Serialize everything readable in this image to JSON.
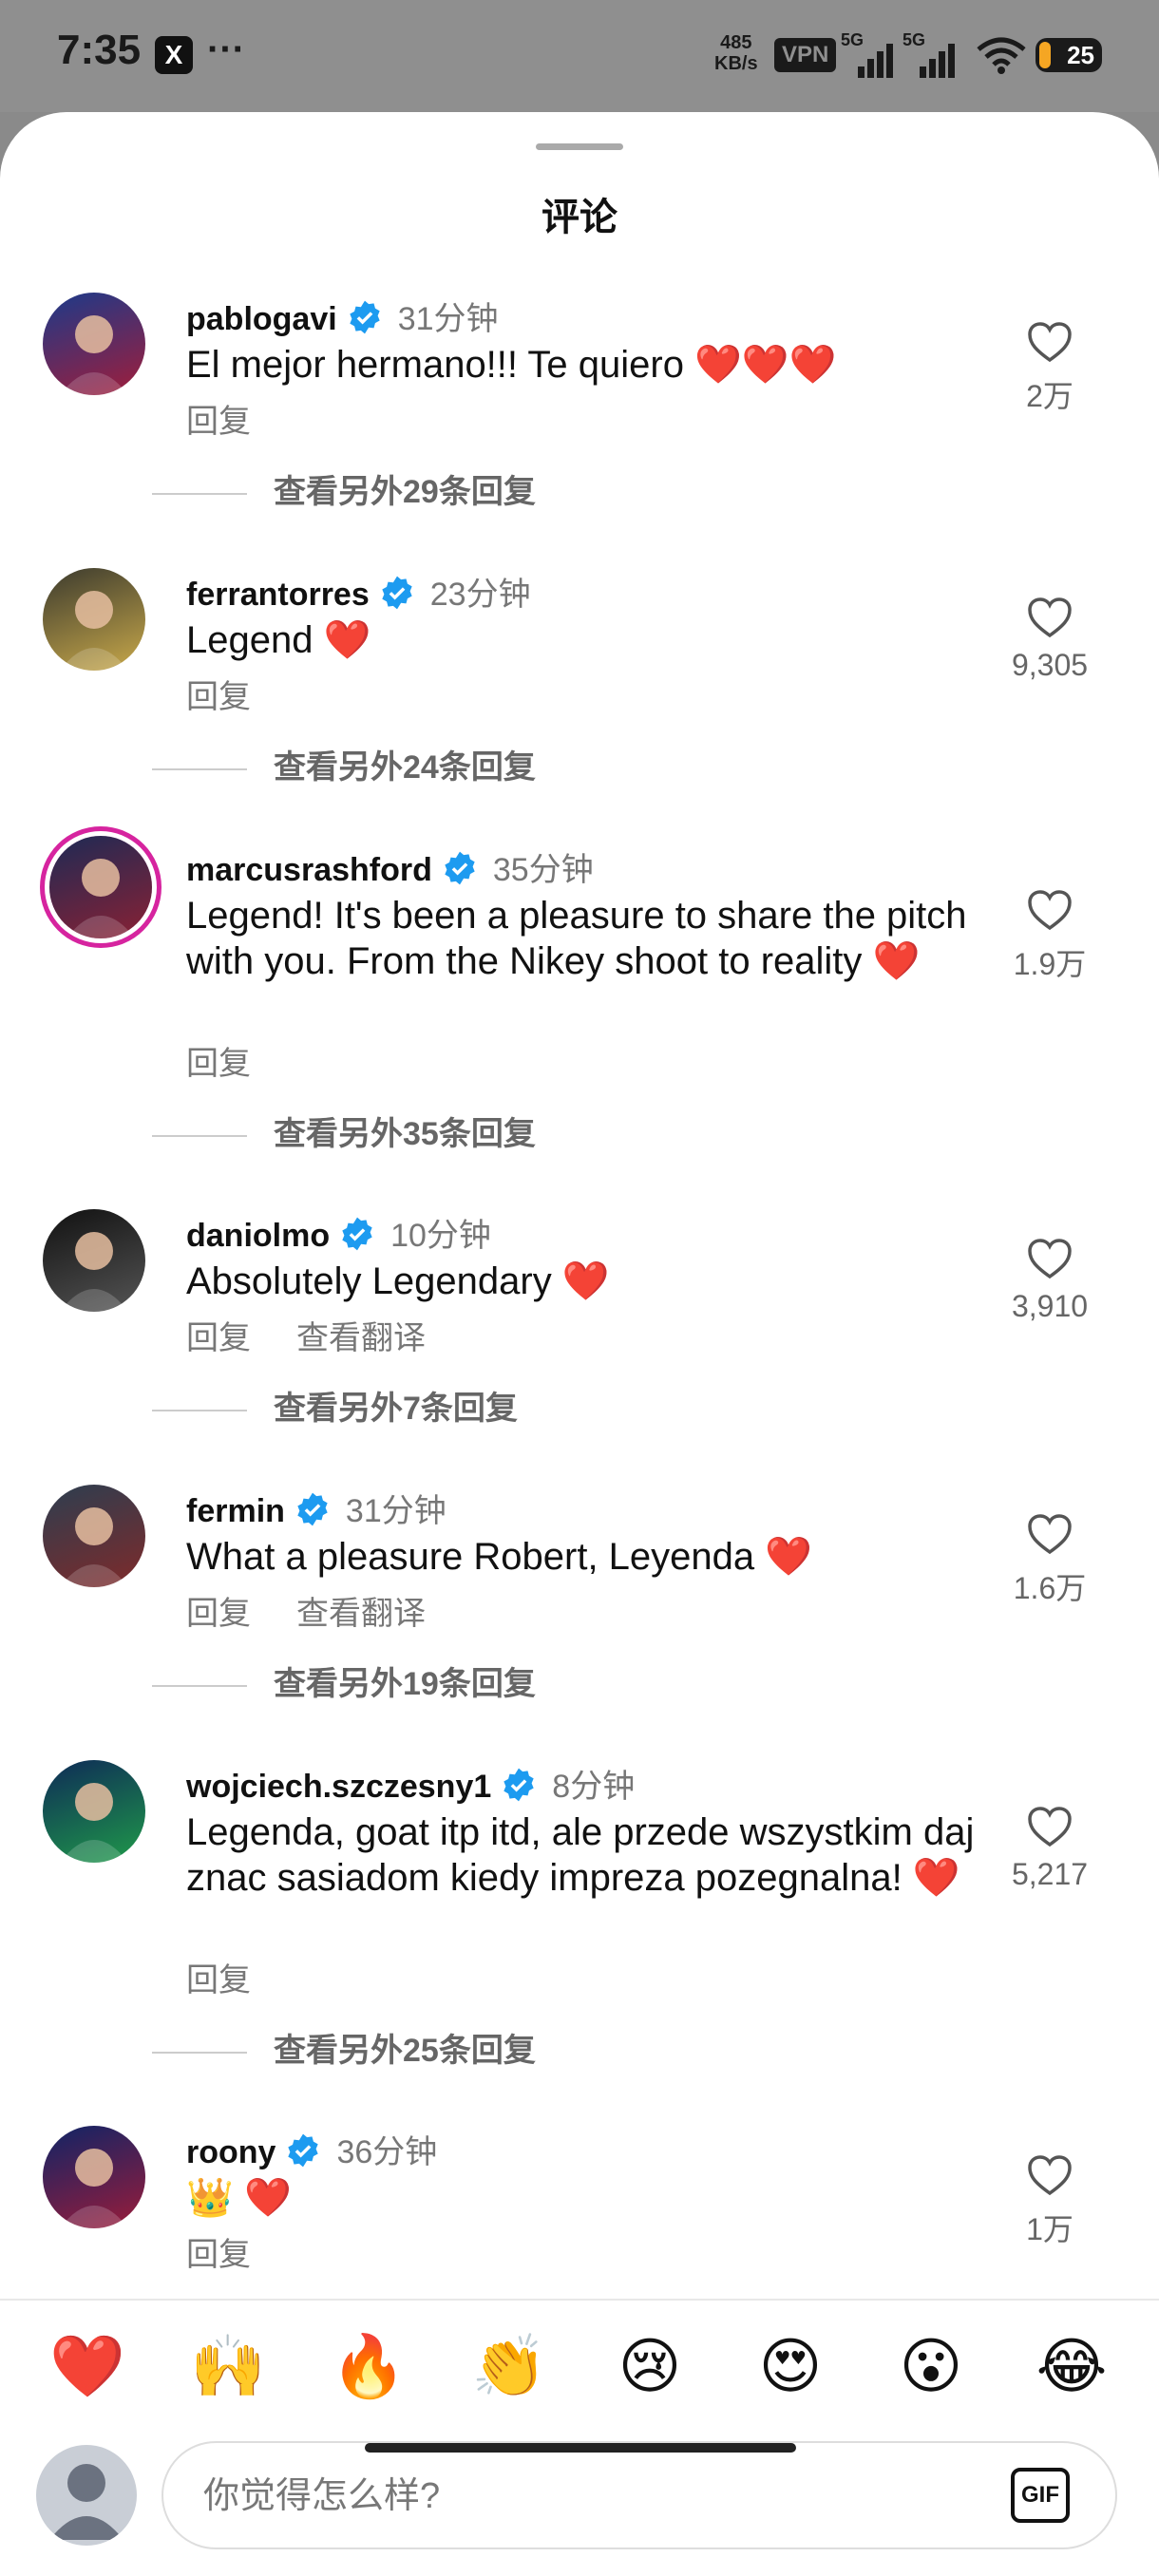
{
  "status_bar": {
    "time": "7:35",
    "app_badge": "X",
    "more": "···",
    "speed_value": "485",
    "speed_unit": "KB/s",
    "vpn": "VPN",
    "signal1": "5G",
    "signal2": "5G",
    "battery": "25"
  },
  "sheet": {
    "title": "评论"
  },
  "comments": [
    {
      "user": "pablogavi",
      "time": "31分钟",
      "text": "El mejor hermano!!! Te quiero",
      "hearts": "❤️❤️❤️",
      "reply": "回复",
      "translate": "",
      "likes": "2万",
      "more": "查看另外29条回复",
      "avatar_colors": [
        "#1b3a8a",
        "#a11d3a"
      ]
    },
    {
      "user": "ferrantorres",
      "time": "23分钟",
      "text": "Legend",
      "hearts": "❤️",
      "reply": "回复",
      "translate": "",
      "likes": "9,305",
      "more": "查看另外24条回复",
      "avatar_colors": [
        "#3b3a2e",
        "#c9a94a"
      ]
    },
    {
      "user": "marcusrashford",
      "time": "35分钟",
      "text": "Legend! It's been a pleasure to share the pitch with you. From the Nikey shoot to reality",
      "hearts": "❤️",
      "reply": "回复",
      "translate": "",
      "likes": "1.9万",
      "more": "查看另外35条回复",
      "avatar_colors": [
        "#1d2a55",
        "#8a2134"
      ]
    },
    {
      "user": "daniolmo",
      "time": "10分钟",
      "text": "Absolutely Legendary",
      "hearts": "❤️",
      "reply": "回复",
      "translate": "查看翻译",
      "likes": "3,910",
      "more": "查看另外7条回复",
      "avatar_colors": [
        "#111111",
        "#555555"
      ]
    },
    {
      "user": "fermin",
      "time": "31分钟",
      "text": "What a pleasure Robert, Leyenda",
      "hearts": "❤️",
      "reply": "回复",
      "translate": "查看翻译",
      "likes": "1.6万",
      "more": "查看另外19条回复",
      "avatar_colors": [
        "#2c3e50",
        "#7f2a2a"
      ]
    },
    {
      "user": "wojciech.szczesny1",
      "time": "8分钟",
      "text": "Legenda, goat itp itd, ale przede wszystkim daj znac sasiadom kiedy impreza pozegnalna!",
      "hearts": "❤️",
      "reply": "回复",
      "translate": "",
      "likes": "5,217",
      "more": "查看另外25条回复",
      "avatar_colors": [
        "#0e2a57",
        "#1f9a4a"
      ]
    },
    {
      "user": "roony",
      "time": "36分钟",
      "text": "👑",
      "hearts": "❤️",
      "reply": "回复",
      "translate": "",
      "likes": "1万",
      "more": "",
      "avatar_colors": [
        "#0f2466",
        "#9b1c3a"
      ]
    }
  ],
  "emoji_bar": [
    "❤️",
    "🙌",
    "🔥",
    "👏",
    "😢",
    "😍",
    "😮",
    "😂"
  ],
  "composer": {
    "placeholder": "你觉得怎么样?",
    "gif": "GIF"
  },
  "icons": {
    "verified": "verified-badge-icon",
    "like": "heart-outline-icon",
    "gif": "gif-icon",
    "avatar": "avatar-placeholder-icon"
  },
  "colors": {
    "verified": "#1d9bf0",
    "heart": "#e8252f",
    "accent_ring": "#d6249f"
  }
}
